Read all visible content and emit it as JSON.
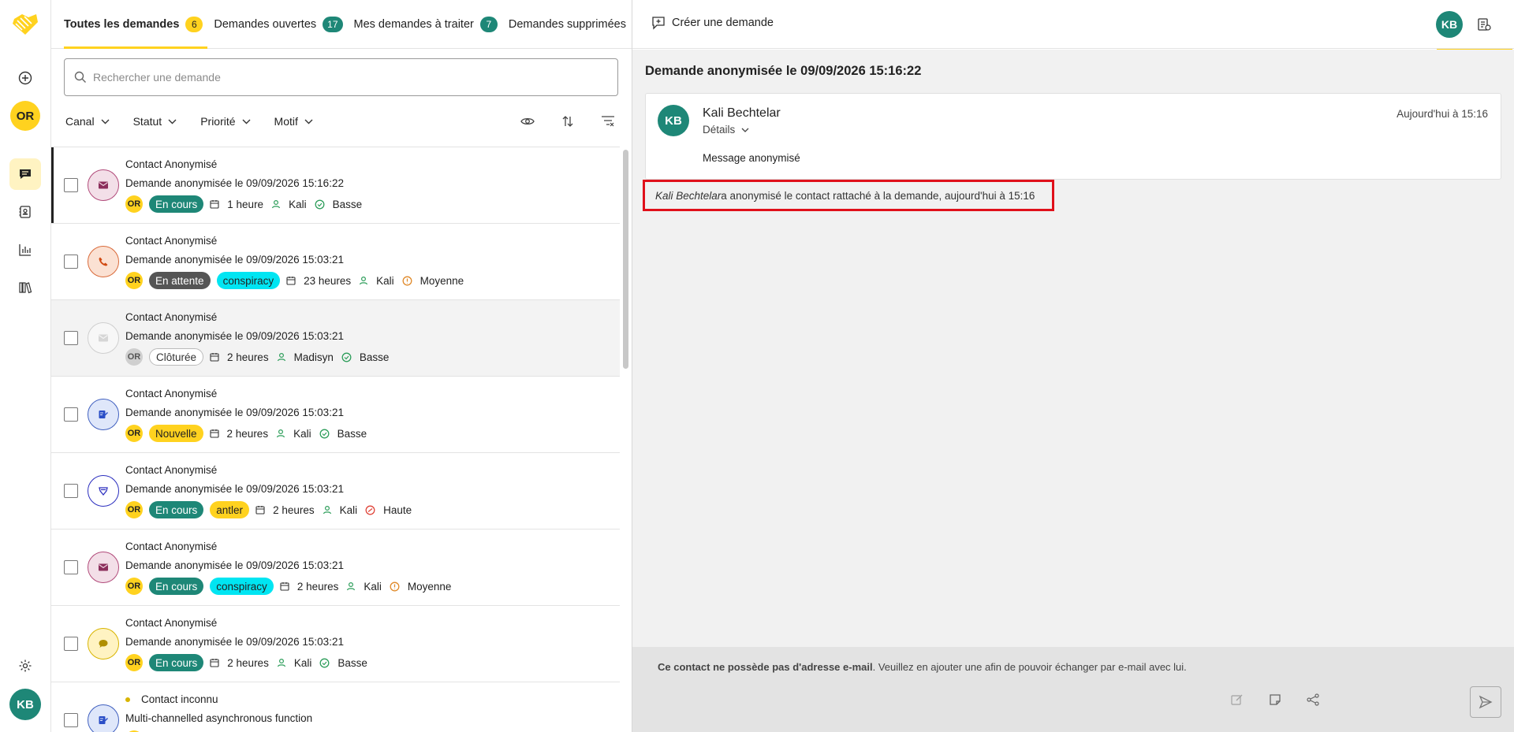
{
  "rail": {
    "user_org_initials": "OR",
    "user_initials": "KB"
  },
  "tabs": [
    {
      "label": "Toutes les demandes",
      "count": "6"
    },
    {
      "label": "Demandes ouvertes",
      "count": "17"
    },
    {
      "label": "Mes demandes à traiter",
      "count": "7"
    },
    {
      "label": "Demandes supprimées",
      "count": null
    }
  ],
  "search": {
    "placeholder": "Rechercher une demande"
  },
  "filters": [
    "Canal",
    "Statut",
    "Priorité",
    "Motif"
  ],
  "requests": [
    {
      "contact": "Contact Anonymisé",
      "subject": "Demande anonymisée le 09/09/2026 15:16:22",
      "org": "OR",
      "channel": "email-icon",
      "status": "En cours",
      "tag": null,
      "age": "1 heure",
      "agent": "Kali",
      "priority": "Basse",
      "selected": true
    },
    {
      "contact": "Contact Anonymisé",
      "subject": "Demande anonymisée le 09/09/2026 15:03:21",
      "org": "OR",
      "channel": "phone-icon",
      "status": "En attente",
      "tag": "conspiracy",
      "age": "23 heures",
      "agent": "Kali",
      "priority": "Moyenne"
    },
    {
      "contact": "Contact Anonymisé",
      "subject": "Demande anonymisée le 09/09/2026 15:03:21",
      "org": "OR",
      "channel": "email-icon",
      "status": "Clôturée",
      "tag": null,
      "age": "2 heures",
      "agent": "Madisyn",
      "priority": "Basse"
    },
    {
      "contact": "Contact Anonymisé",
      "subject": "Demande anonymisée le 09/09/2026 15:03:21",
      "org": "OR",
      "channel": "form-icon",
      "status": "Nouvelle",
      "tag": null,
      "age": "2 heures",
      "agent": "Kali",
      "priority": "Basse"
    },
    {
      "contact": "Contact Anonymisé",
      "subject": "Demande anonymisée le 09/09/2026 15:03:21",
      "org": "OR",
      "channel": "shield-icon",
      "status": "En cours",
      "tag": "antler",
      "age": "2 heures",
      "agent": "Kali",
      "priority": "Haute"
    },
    {
      "contact": "Contact Anonymisé",
      "subject": "Demande anonymisée le 09/09/2026 15:03:21",
      "org": "OR",
      "channel": "email-icon",
      "status": "En cours",
      "tag": "conspiracy",
      "age": "2 heures",
      "agent": "Kali",
      "priority": "Moyenne"
    },
    {
      "contact": "Contact Anonymisé",
      "subject": "Demande anonymisée le 09/09/2026 15:03:21",
      "org": "OR",
      "channel": "chat-icon",
      "status": "En cours",
      "tag": null,
      "age": "2 heures",
      "agent": "Kali",
      "priority": "Basse"
    },
    {
      "contact": "Contact inconnu",
      "subject": "Multi-channelled asynchronous function",
      "org": "OR",
      "channel": "form-icon",
      "status": null,
      "tag": null,
      "age": null,
      "agent": null,
      "priority": null
    }
  ],
  "header": {
    "create_label": "Créer une demande",
    "user_initials": "KB"
  },
  "detail": {
    "title": "Demande anonymisée le 09/09/2026 15:16:22",
    "message": {
      "author": "Kali Bechtelar",
      "author_initials": "KB",
      "details_label": "Détails",
      "time": "Aujourd'hui à 15:16",
      "body": "Message anonymisé"
    },
    "event": {
      "actor": "Kali Bechtelar",
      "text": " a anonymisé le contact rattaché à la demande, aujourd'hui à 15:16"
    },
    "composer_notice_bold": "Ce contact ne possède pas d'adresse e-mail",
    "composer_notice_rest": ". Veuillez en ajouter une afin de pouvoir échanger par e-mail avec lui."
  },
  "colors": {
    "accent_yellow": "#ffd21f",
    "teal": "#1e8777",
    "status_en_cours": "#1e8777",
    "status_en_attente": "#555555",
    "status_nouvelle": "#ffd21f",
    "tag_conspiracy": "#00e5f2",
    "tag_antler": "#ffd21f",
    "highlight_red": "#e0101a"
  }
}
